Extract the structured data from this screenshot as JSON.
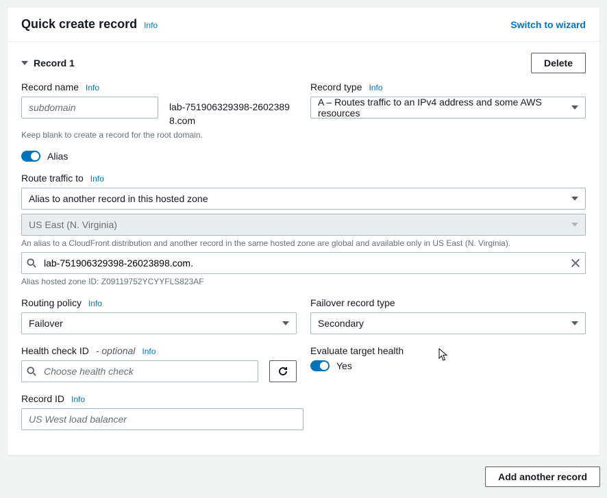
{
  "header": {
    "title": "Quick create record",
    "info": "Info",
    "switch_label": "Switch to wizard"
  },
  "section": {
    "title": "Record 1",
    "delete_label": "Delete"
  },
  "record_name": {
    "label": "Record name",
    "info": "Info",
    "placeholder": "subdomain",
    "value": "",
    "suffix": "lab-751906329398-26023898.com",
    "hint": "Keep blank to create a record for the root domain."
  },
  "record_type": {
    "label": "Record type",
    "info": "Info",
    "value": "A – Routes traffic to an IPv4 address and some AWS resources"
  },
  "alias": {
    "label": "Alias",
    "enabled": true
  },
  "route_traffic": {
    "label": "Route traffic to",
    "info": "Info",
    "target_type": "Alias to another record in this hosted zone",
    "region": "US East (N. Virginia)",
    "region_hint": "An alias to a CloudFront distribution and another record in the same hosted zone are global and available only in US East (N. Virginia).",
    "search_value": "lab-751906329398-26023898.com.",
    "zone_hint": "Alias hosted zone ID: Z09119752YCYYFLS823AF"
  },
  "routing_policy": {
    "label": "Routing policy",
    "info": "Info",
    "value": "Failover"
  },
  "failover_type": {
    "label": "Failover record type",
    "value": "Secondary"
  },
  "health_check": {
    "label": "Health check ID",
    "optional": "- optional",
    "info": "Info",
    "placeholder": "Choose health check",
    "value": ""
  },
  "eval_health": {
    "label": "Evaluate target health",
    "value": "Yes",
    "enabled": true
  },
  "record_id": {
    "label": "Record ID",
    "info": "Info",
    "placeholder": "US West load balancer",
    "value": ""
  },
  "footer": {
    "add_label": "Add another record"
  }
}
